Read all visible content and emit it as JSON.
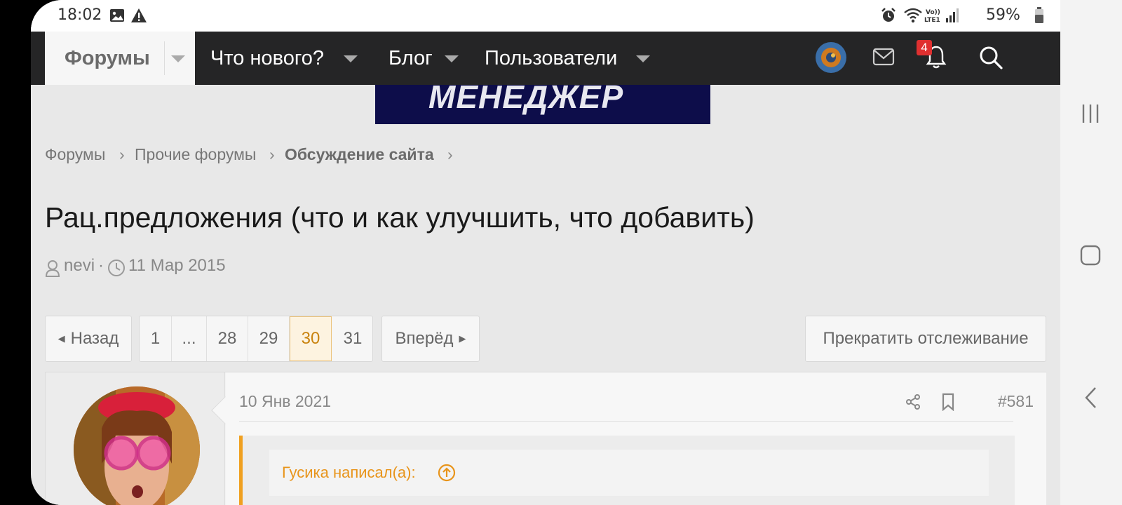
{
  "status_bar": {
    "time": "18:02",
    "battery": "59%",
    "icons": [
      "gallery-icon",
      "warning-icon",
      "alarm-icon",
      "wifi-icon",
      "volte-icon",
      "signal-icon",
      "battery-icon"
    ]
  },
  "nav": {
    "active": "Форумы",
    "items": [
      "Что нового?",
      "Блог",
      "Пользователи"
    ],
    "notification_count": "4"
  },
  "banner": {
    "text": "МЕНЕДЖЕР"
  },
  "breadcrumb": [
    "Форумы",
    "Прочие форумы",
    "Обсуждение сайта"
  ],
  "thread": {
    "title": "Рац.предложения (что и как улучшить, что добавить)",
    "author": "nevi",
    "separator": "·",
    "date": "11 Мар 2015"
  },
  "pagination": {
    "prev": "Назад",
    "next": "Вперёд",
    "pages": [
      "1",
      "...",
      "28",
      "29",
      "30",
      "31"
    ],
    "current": "30",
    "unwatch": "Прекратить отслеживание"
  },
  "post": {
    "date": "10 Янв 2021",
    "number": "#581",
    "quote_author": "Гусика написал(а):"
  },
  "colors": {
    "nav_bg": "#252526",
    "accent": "#e8941a",
    "notification_badge": "#e03030",
    "page_bg": "#e8e8e8"
  }
}
